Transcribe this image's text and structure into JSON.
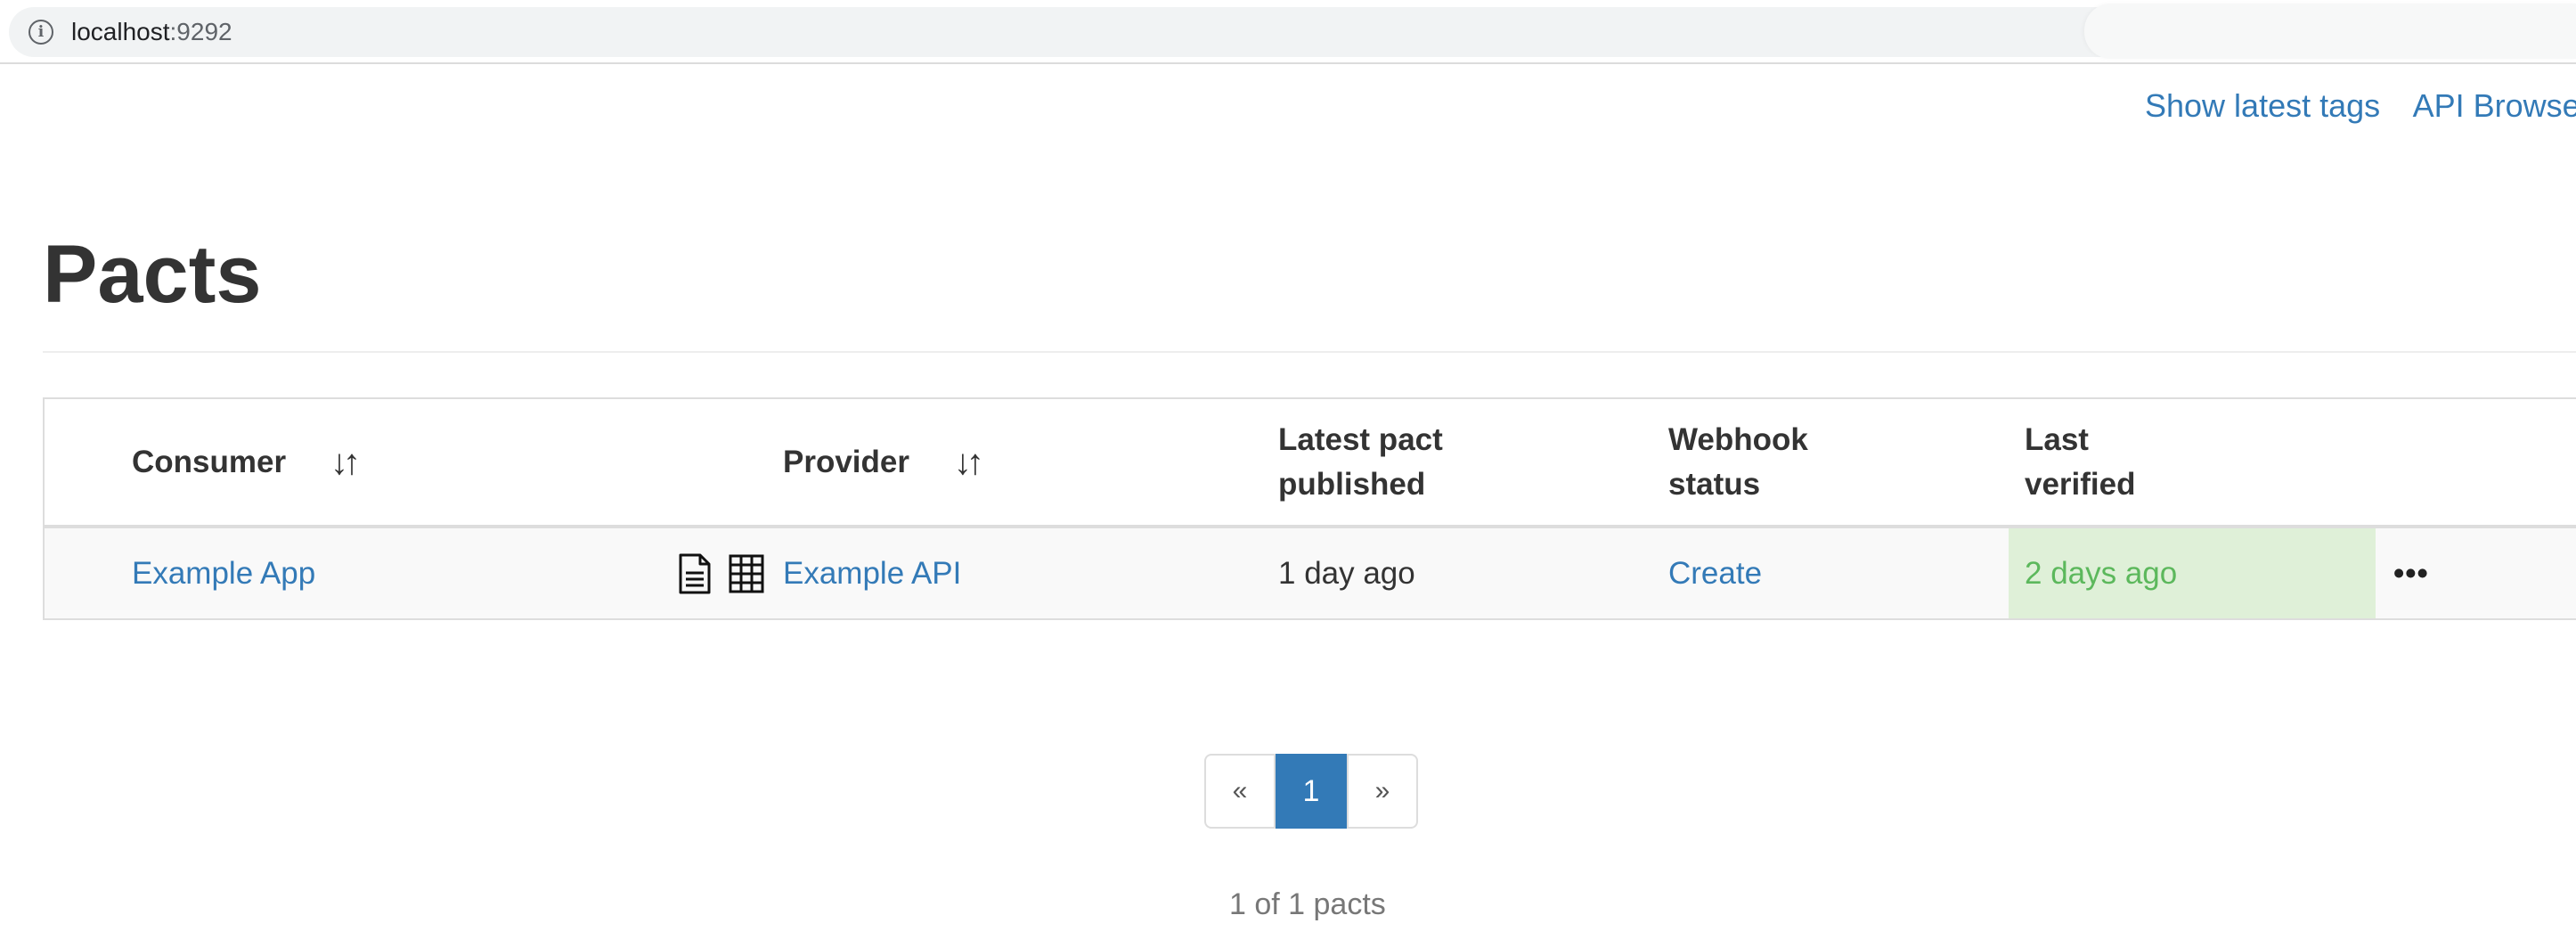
{
  "browser": {
    "url_host": "localhost",
    "url_port": ":9292"
  },
  "top_nav": {
    "links": [
      "Show latest tags",
      "API Browser"
    ]
  },
  "page": {
    "title": "Pacts"
  },
  "table": {
    "headers": {
      "consumer": "Consumer",
      "provider": "Provider",
      "latest_line1": "Latest pact",
      "latest_line2": "published",
      "webhook_line1": "Webhook",
      "webhook_line2": "status",
      "verified_line1": "Last",
      "verified_line2": "verified"
    },
    "rows": [
      {
        "consumer": "Example App",
        "provider": "Example API",
        "latest_published": "1 day ago",
        "webhook_status": "Create",
        "last_verified": "2 days ago",
        "actions": "•••"
      }
    ]
  },
  "pagination": {
    "prev": "«",
    "current": "1",
    "next": "»",
    "summary": "1 of 1 pacts"
  },
  "colors": {
    "link": "#337ab7",
    "success_bg": "#dff0d8",
    "success_text": "#5cb85c",
    "active_page": "#337ab7"
  },
  "icons": [
    "info-icon",
    "sort-icon",
    "document-icon",
    "matrix-icon",
    "more-icon"
  ]
}
